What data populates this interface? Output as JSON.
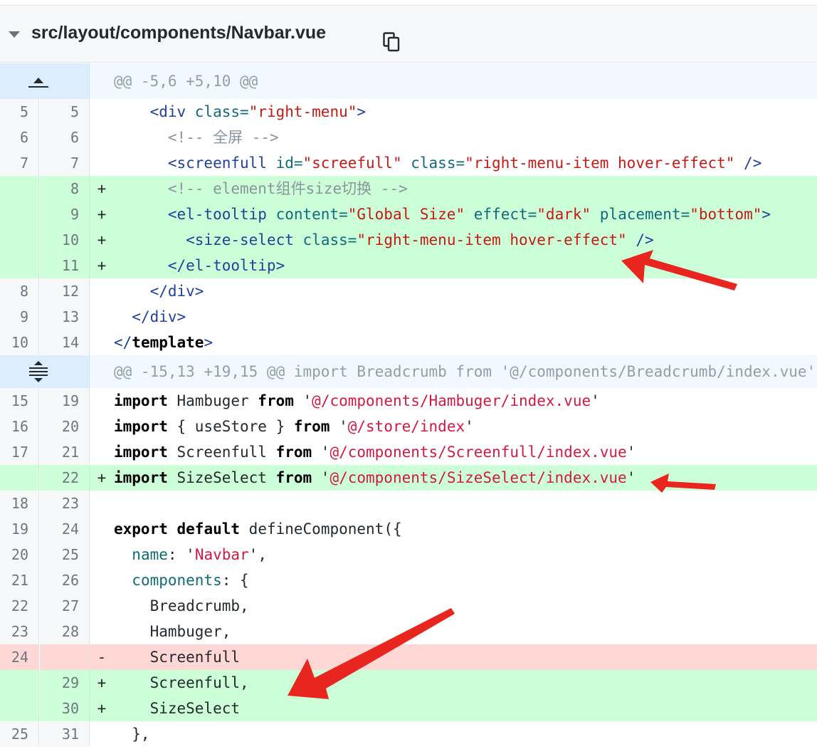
{
  "file": {
    "name": "src/layout/components/Navbar.vue"
  },
  "icons": {
    "collapse": "caret-down-icon",
    "copy": "copy-icon",
    "expand_up": "expand-up-icon",
    "expand_both": "expand-both-icon"
  },
  "annotation_color": "#e8261f",
  "lines": [
    {
      "type": "hunk",
      "expander": "up",
      "text": "@@ -5,6 +5,10 @@"
    },
    {
      "type": "ctx",
      "old": "5",
      "new": "5",
      "tokens": [
        [
          "",
          "    "
        ],
        [
          "tag",
          "<div "
        ],
        [
          "attr",
          "class="
        ],
        [
          "str",
          "\"right-menu\""
        ],
        [
          "tag",
          ">"
        ]
      ]
    },
    {
      "type": "ctx",
      "old": "6",
      "new": "6",
      "tokens": [
        [
          "",
          "      "
        ],
        [
          "cmt",
          "<!-- 全屏 -->"
        ]
      ]
    },
    {
      "type": "ctx",
      "old": "7",
      "new": "7",
      "tokens": [
        [
          "",
          "      "
        ],
        [
          "tag",
          "<screenfull "
        ],
        [
          "attr",
          "id="
        ],
        [
          "str",
          "\"screefull\""
        ],
        [
          "",
          " "
        ],
        [
          "attr",
          "class="
        ],
        [
          "str",
          "\"right-menu-item hover-effect\""
        ],
        [
          "tag",
          " />"
        ]
      ]
    },
    {
      "type": "add",
      "old": "",
      "new": "8",
      "marker": "+",
      "tokens": [
        [
          "",
          "      "
        ],
        [
          "cmt",
          "<!-- element组件size切换 -->"
        ]
      ]
    },
    {
      "type": "add",
      "old": "",
      "new": "9",
      "marker": "+",
      "tokens": [
        [
          "",
          "      "
        ],
        [
          "tag",
          "<el-tooltip "
        ],
        [
          "attr",
          "content="
        ],
        [
          "str",
          "\"Global Size\""
        ],
        [
          "",
          " "
        ],
        [
          "attr",
          "effect="
        ],
        [
          "str",
          "\"dark\""
        ],
        [
          "",
          " "
        ],
        [
          "attr",
          "placement="
        ],
        [
          "str",
          "\"bottom\""
        ],
        [
          "tag",
          ">"
        ]
      ]
    },
    {
      "type": "add",
      "old": "",
      "new": "10",
      "marker": "+",
      "tokens": [
        [
          "",
          "        "
        ],
        [
          "tag",
          "<size-select "
        ],
        [
          "attr",
          "class="
        ],
        [
          "str",
          "\"right-menu-item hover-effect\""
        ],
        [
          "tag",
          " />"
        ]
      ]
    },
    {
      "type": "add",
      "old": "",
      "new": "11",
      "marker": "+",
      "tokens": [
        [
          "",
          "      "
        ],
        [
          "tag",
          "</el-tooltip>"
        ]
      ]
    },
    {
      "type": "ctx",
      "old": "8",
      "new": "12",
      "tokens": [
        [
          "",
          "    "
        ],
        [
          "tag",
          "</div>"
        ]
      ]
    },
    {
      "type": "ctx",
      "old": "9",
      "new": "13",
      "tokens": [
        [
          "",
          "  "
        ],
        [
          "tag",
          "</div>"
        ]
      ]
    },
    {
      "type": "ctx",
      "old": "10",
      "new": "14",
      "tokens": [
        [
          "tag",
          "</"
        ],
        [
          "kw",
          "template"
        ],
        [
          "tag",
          ">"
        ]
      ]
    },
    {
      "type": "hunk",
      "expander": "both",
      "text": "@@ -15,13 +19,15 @@ import Breadcrumb from '@/components/Breadcrumb/index.vue'"
    },
    {
      "type": "ctx",
      "old": "15",
      "new": "19",
      "tokens": [
        [
          "kw",
          "import"
        ],
        [
          "",
          " Hambuger "
        ],
        [
          "kw",
          "from"
        ],
        [
          "",
          " '"
        ],
        [
          "path",
          "@/components/Hambuger/index.vue"
        ],
        [
          "",
          "'"
        ]
      ]
    },
    {
      "type": "ctx",
      "old": "16",
      "new": "20",
      "tokens": [
        [
          "kw",
          "import"
        ],
        [
          "",
          " { useStore } "
        ],
        [
          "kw",
          "from"
        ],
        [
          "",
          " '"
        ],
        [
          "path",
          "@/store/index"
        ],
        [
          "",
          "'"
        ]
      ]
    },
    {
      "type": "ctx",
      "old": "17",
      "new": "21",
      "tokens": [
        [
          "kw",
          "import"
        ],
        [
          "",
          " Screenfull "
        ],
        [
          "kw",
          "from"
        ],
        [
          "",
          " '"
        ],
        [
          "path",
          "@/components/Screenfull/index.vue"
        ],
        [
          "",
          "'"
        ]
      ]
    },
    {
      "type": "add",
      "old": "",
      "new": "22",
      "marker": "+",
      "tokens": [
        [
          "kw",
          "import"
        ],
        [
          "",
          " SizeSelect "
        ],
        [
          "kw",
          "from"
        ],
        [
          "",
          " '"
        ],
        [
          "path",
          "@/components/SizeSelect/index.vue"
        ],
        [
          "",
          "'"
        ]
      ]
    },
    {
      "type": "ctx",
      "old": "18",
      "new": "23",
      "tokens": []
    },
    {
      "type": "ctx",
      "old": "19",
      "new": "24",
      "tokens": [
        [
          "kw",
          "export"
        ],
        [
          "",
          " "
        ],
        [
          "kw",
          "default"
        ],
        [
          "",
          " defineComponent({"
        ]
      ]
    },
    {
      "type": "ctx",
      "old": "20",
      "new": "25",
      "tokens": [
        [
          "",
          "  "
        ],
        [
          "attr",
          "name"
        ],
        [
          "",
          ": '"
        ],
        [
          "path",
          "Navbar"
        ],
        [
          "",
          "',"
        ]
      ]
    },
    {
      "type": "ctx",
      "old": "21",
      "new": "26",
      "tokens": [
        [
          "",
          "  "
        ],
        [
          "attr",
          "components"
        ],
        [
          "",
          ": {"
        ]
      ]
    },
    {
      "type": "ctx",
      "old": "22",
      "new": "27",
      "tokens": [
        [
          "",
          "    Breadcrumb,"
        ]
      ]
    },
    {
      "type": "ctx",
      "old": "23",
      "new": "28",
      "tokens": [
        [
          "",
          "    Hambuger,"
        ]
      ]
    },
    {
      "type": "del",
      "old": "24",
      "new": "",
      "marker": "-",
      "tokens": [
        [
          "",
          "    Screenfull"
        ]
      ]
    },
    {
      "type": "add",
      "old": "",
      "new": "29",
      "marker": "+",
      "tokens": [
        [
          "",
          "    Screenfull,"
        ]
      ]
    },
    {
      "type": "add",
      "old": "",
      "new": "30",
      "marker": "+",
      "tokens": [
        [
          "",
          "    SizeSelect"
        ]
      ]
    },
    {
      "type": "ctx",
      "old": "25",
      "new": "31",
      "tokens": [
        [
          "",
          "  },"
        ]
      ]
    }
  ]
}
